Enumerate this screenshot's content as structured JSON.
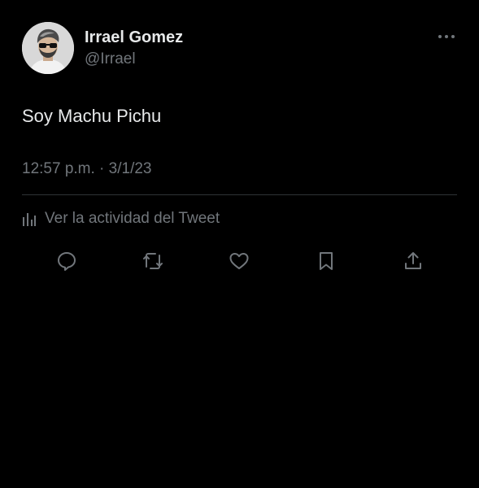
{
  "tweet": {
    "author": {
      "display_name": "Irrael Gomez",
      "handle": "@Irrael",
      "avatar_icon": "profile-photo"
    },
    "more_icon": "more-options-icon",
    "text": "Soy Machu Pichu",
    "timestamp": "12:57 p.m. · 3/1/23",
    "analytics": {
      "icon": "bar-chart-icon",
      "label": "Ver la actividad del Tweet"
    },
    "actions": [
      {
        "name": "reply",
        "icon": "reply-icon"
      },
      {
        "name": "retweet",
        "icon": "retweet-icon"
      },
      {
        "name": "like",
        "icon": "heart-icon"
      },
      {
        "name": "bookmark",
        "icon": "bookmark-icon"
      },
      {
        "name": "share",
        "icon": "share-icon"
      }
    ]
  },
  "colors": {
    "background": "#000000",
    "primary_text": "#e7e9ea",
    "secondary_text": "#71767b",
    "divider": "#2f3336"
  }
}
